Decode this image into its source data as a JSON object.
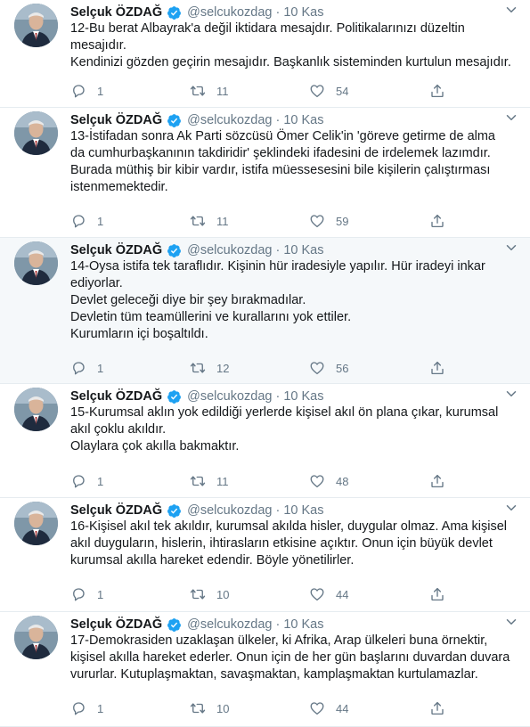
{
  "icons": {
    "verified": "verified-badge-icon",
    "caret": "chevron-down-icon",
    "reply": "reply-icon",
    "retweet": "retweet-icon",
    "like": "heart-icon",
    "share": "share-icon"
  },
  "colors": {
    "verified": "#1da1f2",
    "muted": "#657786",
    "highlight_bg": "#f5f8fa"
  },
  "tweets": [
    {
      "name": "Selçuk ÖZDAĞ",
      "handle": "@selcukozdag",
      "dot": "·",
      "date": "10 Kas",
      "lines": [
        "12-Bu berat Albayrak'a değil iktidara mesajdır. Politikalarınızı düzeltin",
        "mesajıdır.",
        "Kendinizi gözden geçirin mesajıdır. Başkanlık sisteminden kurtulun mesajıdır."
      ],
      "replies": "1",
      "retweets": "11",
      "likes": "54"
    },
    {
      "name": "Selçuk ÖZDAĞ",
      "handle": "@selcukozdag",
      "dot": "·",
      "date": "10 Kas",
      "lines": [
        "13-İstifadan sonra Ak Parti sözcüsü Ömer Celik'in 'göreve getirme de alma",
        "da cumhurbaşkanının takdiridir' şeklindeki ifadesini de irdelemek lazımdır.",
        "Burada müthiş bir kibir vardır, istifa müessesesini bile kişilerin çalıştırması",
        "istenmemektedir."
      ],
      "replies": "1",
      "retweets": "11",
      "likes": "59"
    },
    {
      "name": "Selçuk ÖZDAĞ",
      "handle": "@selcukozdag",
      "dot": "·",
      "date": "10 Kas",
      "lines": [
        "14-Oysa istifa tek taraflıdır. Kişinin hür iradesiyle yapılır. Hür iradeyi inkar",
        "ediyorlar.",
        "Devlet geleceği diye bir şey bırakmadılar.",
        "Devletin tüm teamüllerini ve kurallarını yok ettiler.",
        "Kurumların içi boşaltıldı."
      ],
      "replies": "1",
      "retweets": "12",
      "likes": "56"
    },
    {
      "name": "Selçuk ÖZDAĞ",
      "handle": "@selcukozdag",
      "dot": "·",
      "date": "10 Kas",
      "lines": [
        "15-Kurumsal aklın yok edildiği yerlerde kişisel akıl ön plana çıkar, kurumsal",
        "akıl çoklu akıldır.",
        "Olaylara çok akılla bakmaktır."
      ],
      "replies": "1",
      "retweets": "11",
      "likes": "48"
    },
    {
      "name": "Selçuk ÖZDAĞ",
      "handle": "@selcukozdag",
      "dot": "·",
      "date": "10 Kas",
      "lines": [
        "16-Kişisel akıl tek akıldır, kurumsal akılda hisler, duygular olmaz. Ama kişisel",
        "akıl duyguların, hislerin, ihtirasların etkisine açıktır. Onun için büyük devlet",
        "kurumsal akılla hareket edendir. Böyle yönetilirler."
      ],
      "replies": "1",
      "retweets": "10",
      "likes": "44"
    },
    {
      "name": "Selçuk ÖZDAĞ",
      "handle": "@selcukozdag",
      "dot": "·",
      "date": "10 Kas",
      "lines": [
        "17-Demokrasiden uzaklaşan ülkeler, ki Afrika, Arap ülkeleri buna örnektir,",
        "kişisel akılla hareket ederler. Onun için de her gün başlarını duvardan duvara",
        "vururlar. Kutuplaşmaktan, savaşmaktan, kamplaşmaktan kurtulamazlar."
      ],
      "replies": "1",
      "retweets": "10",
      "likes": "44"
    }
  ]
}
